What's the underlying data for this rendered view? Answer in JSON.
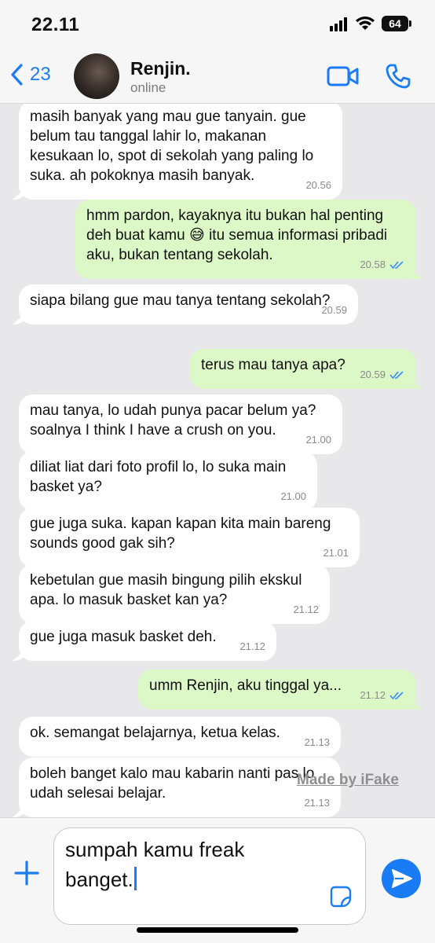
{
  "status": {
    "time": "22.11",
    "battery": "64"
  },
  "header": {
    "back_count": "23",
    "name": "Renjin.",
    "presence": "online"
  },
  "messages": [
    {
      "dir": "in",
      "text": "masih banyak yang mau gue tanyain. gue belum tau tanggal lahir lo, makanan kesukaan lo, spot di sekolah yang paling lo suka. ah pokoknya masih banyak.",
      "time": "20.56",
      "read": false
    },
    {
      "dir": "out",
      "text": "hmm pardon, kayaknya itu bukan hal penting deh buat kamu 😅 itu semua informasi pribadi aku, bukan tentang sekolah.",
      "time": "20.58",
      "read": true
    },
    {
      "dir": "in",
      "text": "siapa bilang gue mau tanya tentang sekolah?",
      "time": "20.59",
      "read": false
    },
    {
      "dir": "out",
      "text": "terus mau tanya apa?",
      "time": "20.59",
      "read": true
    },
    {
      "dir": "in",
      "text": "mau tanya, lo udah punya pacar belum ya? soalnya I think I have a crush on you.",
      "time": "21.00",
      "read": false
    },
    {
      "dir": "in",
      "text": "diliat liat dari foto profil lo, lo suka main basket ya?",
      "time": "21.00",
      "read": false
    },
    {
      "dir": "in",
      "text": "gue juga suka. kapan kapan kita main bareng sounds good gak sih?",
      "time": "21.01",
      "read": false
    },
    {
      "dir": "in",
      "text": "kebetulan gue masih bingung pilih ekskul apa. lo masuk basket kan ya?",
      "time": "21.12",
      "read": false
    },
    {
      "dir": "in",
      "text": "gue juga masuk basket deh.",
      "time": "21.12",
      "read": false
    },
    {
      "dir": "out",
      "text": "umm Renjin, aku tinggal ya...",
      "time": "21.12",
      "read": true
    },
    {
      "dir": "in",
      "text": "ok. semangat belajarnya, ketua kelas.",
      "time": "21.13",
      "read": false
    },
    {
      "dir": "in",
      "text": "boleh banget kalo mau kabarin nanti pas lo udah selesai belajar.",
      "time": "21.13",
      "read": false
    }
  ],
  "watermark": "Made by iFake",
  "composer": {
    "text": "sumpah kamu freak\nbanget."
  },
  "colors": {
    "accent": "#1a7cf5",
    "outgoing": "#dcf8c6",
    "incoming": "#ffffff",
    "background": "#e8e8ea"
  },
  "icons": [
    "chevron-left-icon",
    "video-camera-icon",
    "phone-icon",
    "plus-icon",
    "sticker-icon",
    "send-icon",
    "double-check-icon"
  ]
}
